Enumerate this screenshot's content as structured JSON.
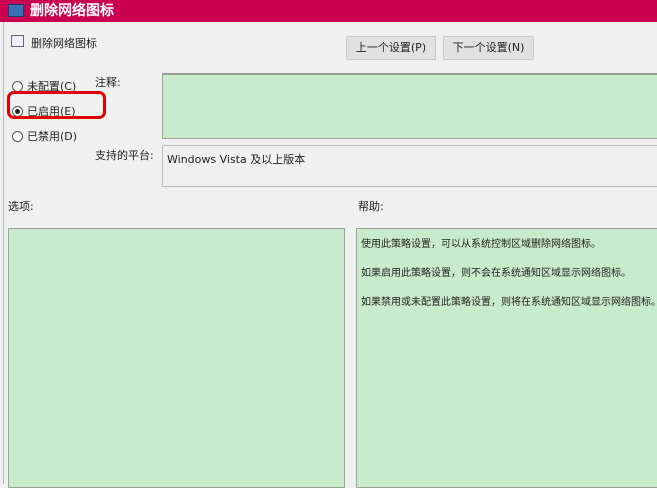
{
  "window": {
    "title": "删除网络图标"
  },
  "header": {
    "policy_name": "删除网络图标",
    "prev_button": "上一个设置(P)",
    "next_button": "下一个设置(N)"
  },
  "state": {
    "options": [
      {
        "label": "未配置(C)",
        "selected": false
      },
      {
        "label": "已启用(E)",
        "selected": true
      },
      {
        "label": "已禁用(D)",
        "selected": false
      }
    ]
  },
  "comment": {
    "label": "注释:",
    "value": ""
  },
  "platform": {
    "label": "支持的平台:",
    "value": "Windows Vista 及以上版本"
  },
  "options_label": "选项:",
  "help_label": "帮助:",
  "help_text": [
    "使用此策略设置，可以从系统控制区域删除网络图标。",
    "如果启用此策略设置，则不会在系统通知区域显示网络图标。",
    "如果禁用或未配置此策略设置，则将在系统通知区域显示网络图标。"
  ],
  "colors": {
    "title_bar": "#c8004f",
    "pane": "#c8eccb",
    "highlight": "#e00000"
  }
}
